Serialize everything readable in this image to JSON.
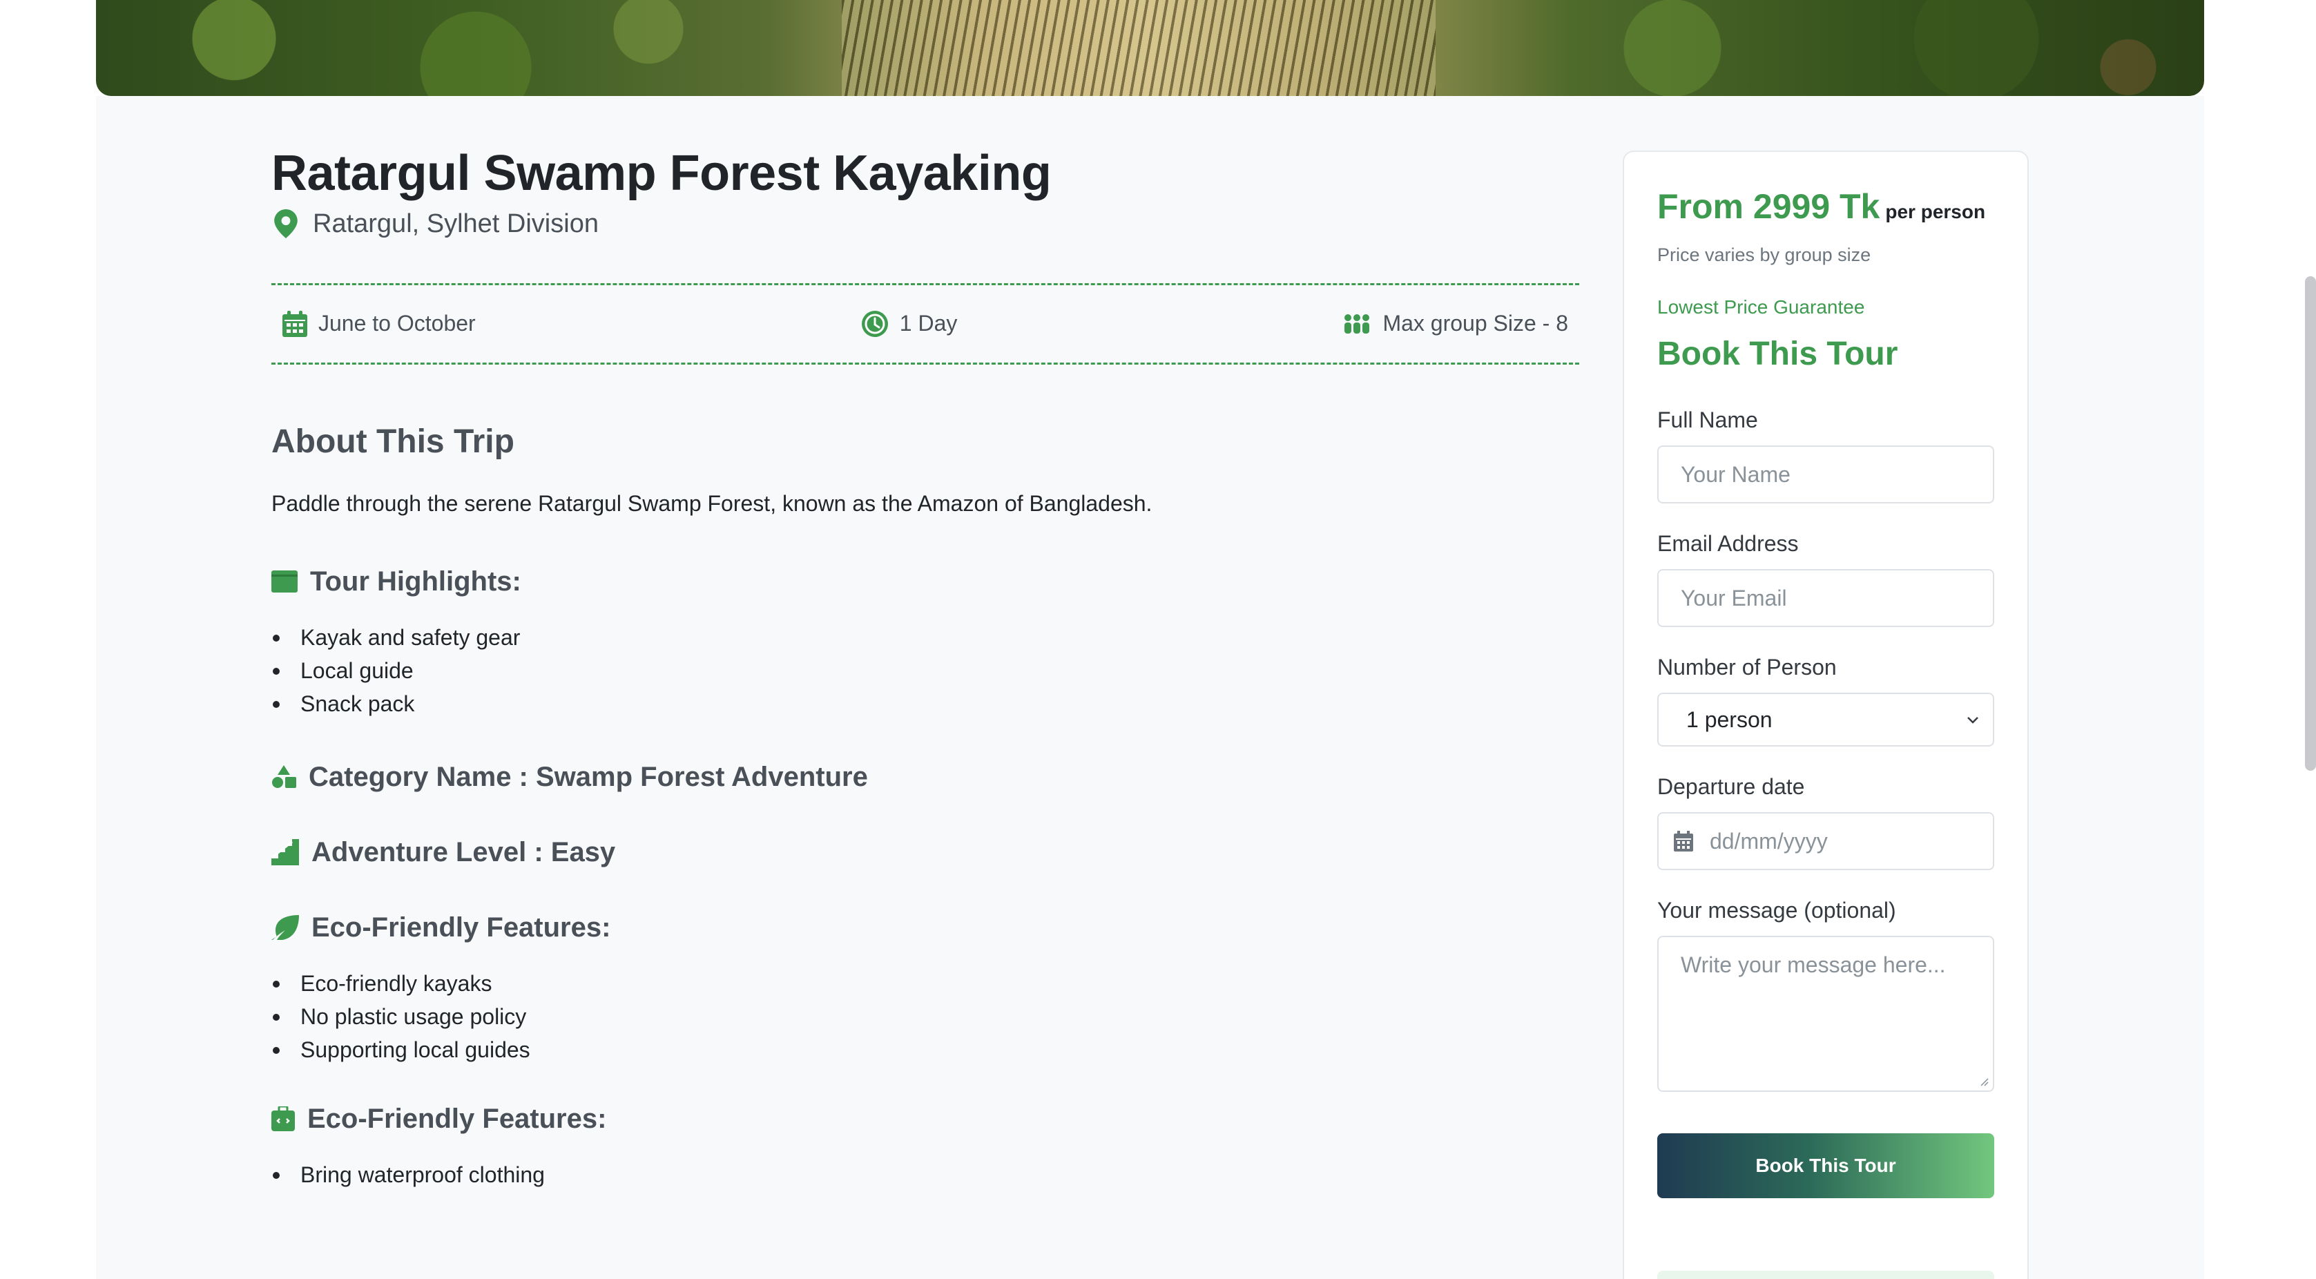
{
  "tour": {
    "title": "Ratargul Swamp Forest Kayaking",
    "location": "Ratargul, Sylhet Division",
    "season": "June to October",
    "duration": "1 Day",
    "group_size": "Max group Size - 8"
  },
  "about": {
    "heading": "About This Trip",
    "description": "Paddle through the serene Ratargul Swamp Forest, known as the Amazon of Bangladesh."
  },
  "highlights": {
    "heading": "Tour Highlights:",
    "items": [
      "Kayak and safety gear",
      "Local guide",
      "Snack pack"
    ]
  },
  "category": {
    "text": "Category Name : Swamp Forest Adventure"
  },
  "adventure": {
    "text": "Adventure Level : Easy"
  },
  "eco": {
    "heading": "Eco-Friendly Features:",
    "items": [
      "Eco-friendly kayaks",
      "No plastic usage policy",
      "Supporting local guides"
    ]
  },
  "packing": {
    "heading": "Eco-Friendly Features:",
    "items": [
      "Bring waterproof clothing"
    ]
  },
  "booking": {
    "price": "From 2999 Tk",
    "per": "per person",
    "price_note": "Price varies by group size",
    "guarantee": "Lowest Price Guarantee",
    "heading": "Book This Tour",
    "name_label": "Full Name",
    "name_placeholder": "Your Name",
    "email_label": "Email Address",
    "email_placeholder": "Your Email",
    "persons_label": "Number of Person",
    "persons_value": "1 person",
    "date_label": "Departure date",
    "date_placeholder": "dd/mm/yyyy",
    "message_label": "Your message (optional)",
    "message_placeholder": "Write your message here...",
    "submit_label": "Book This Tour"
  },
  "colors": {
    "accent": "#3d9a4e",
    "button_gradient_start": "#1f3b52",
    "button_gradient_end": "#72c77e"
  }
}
